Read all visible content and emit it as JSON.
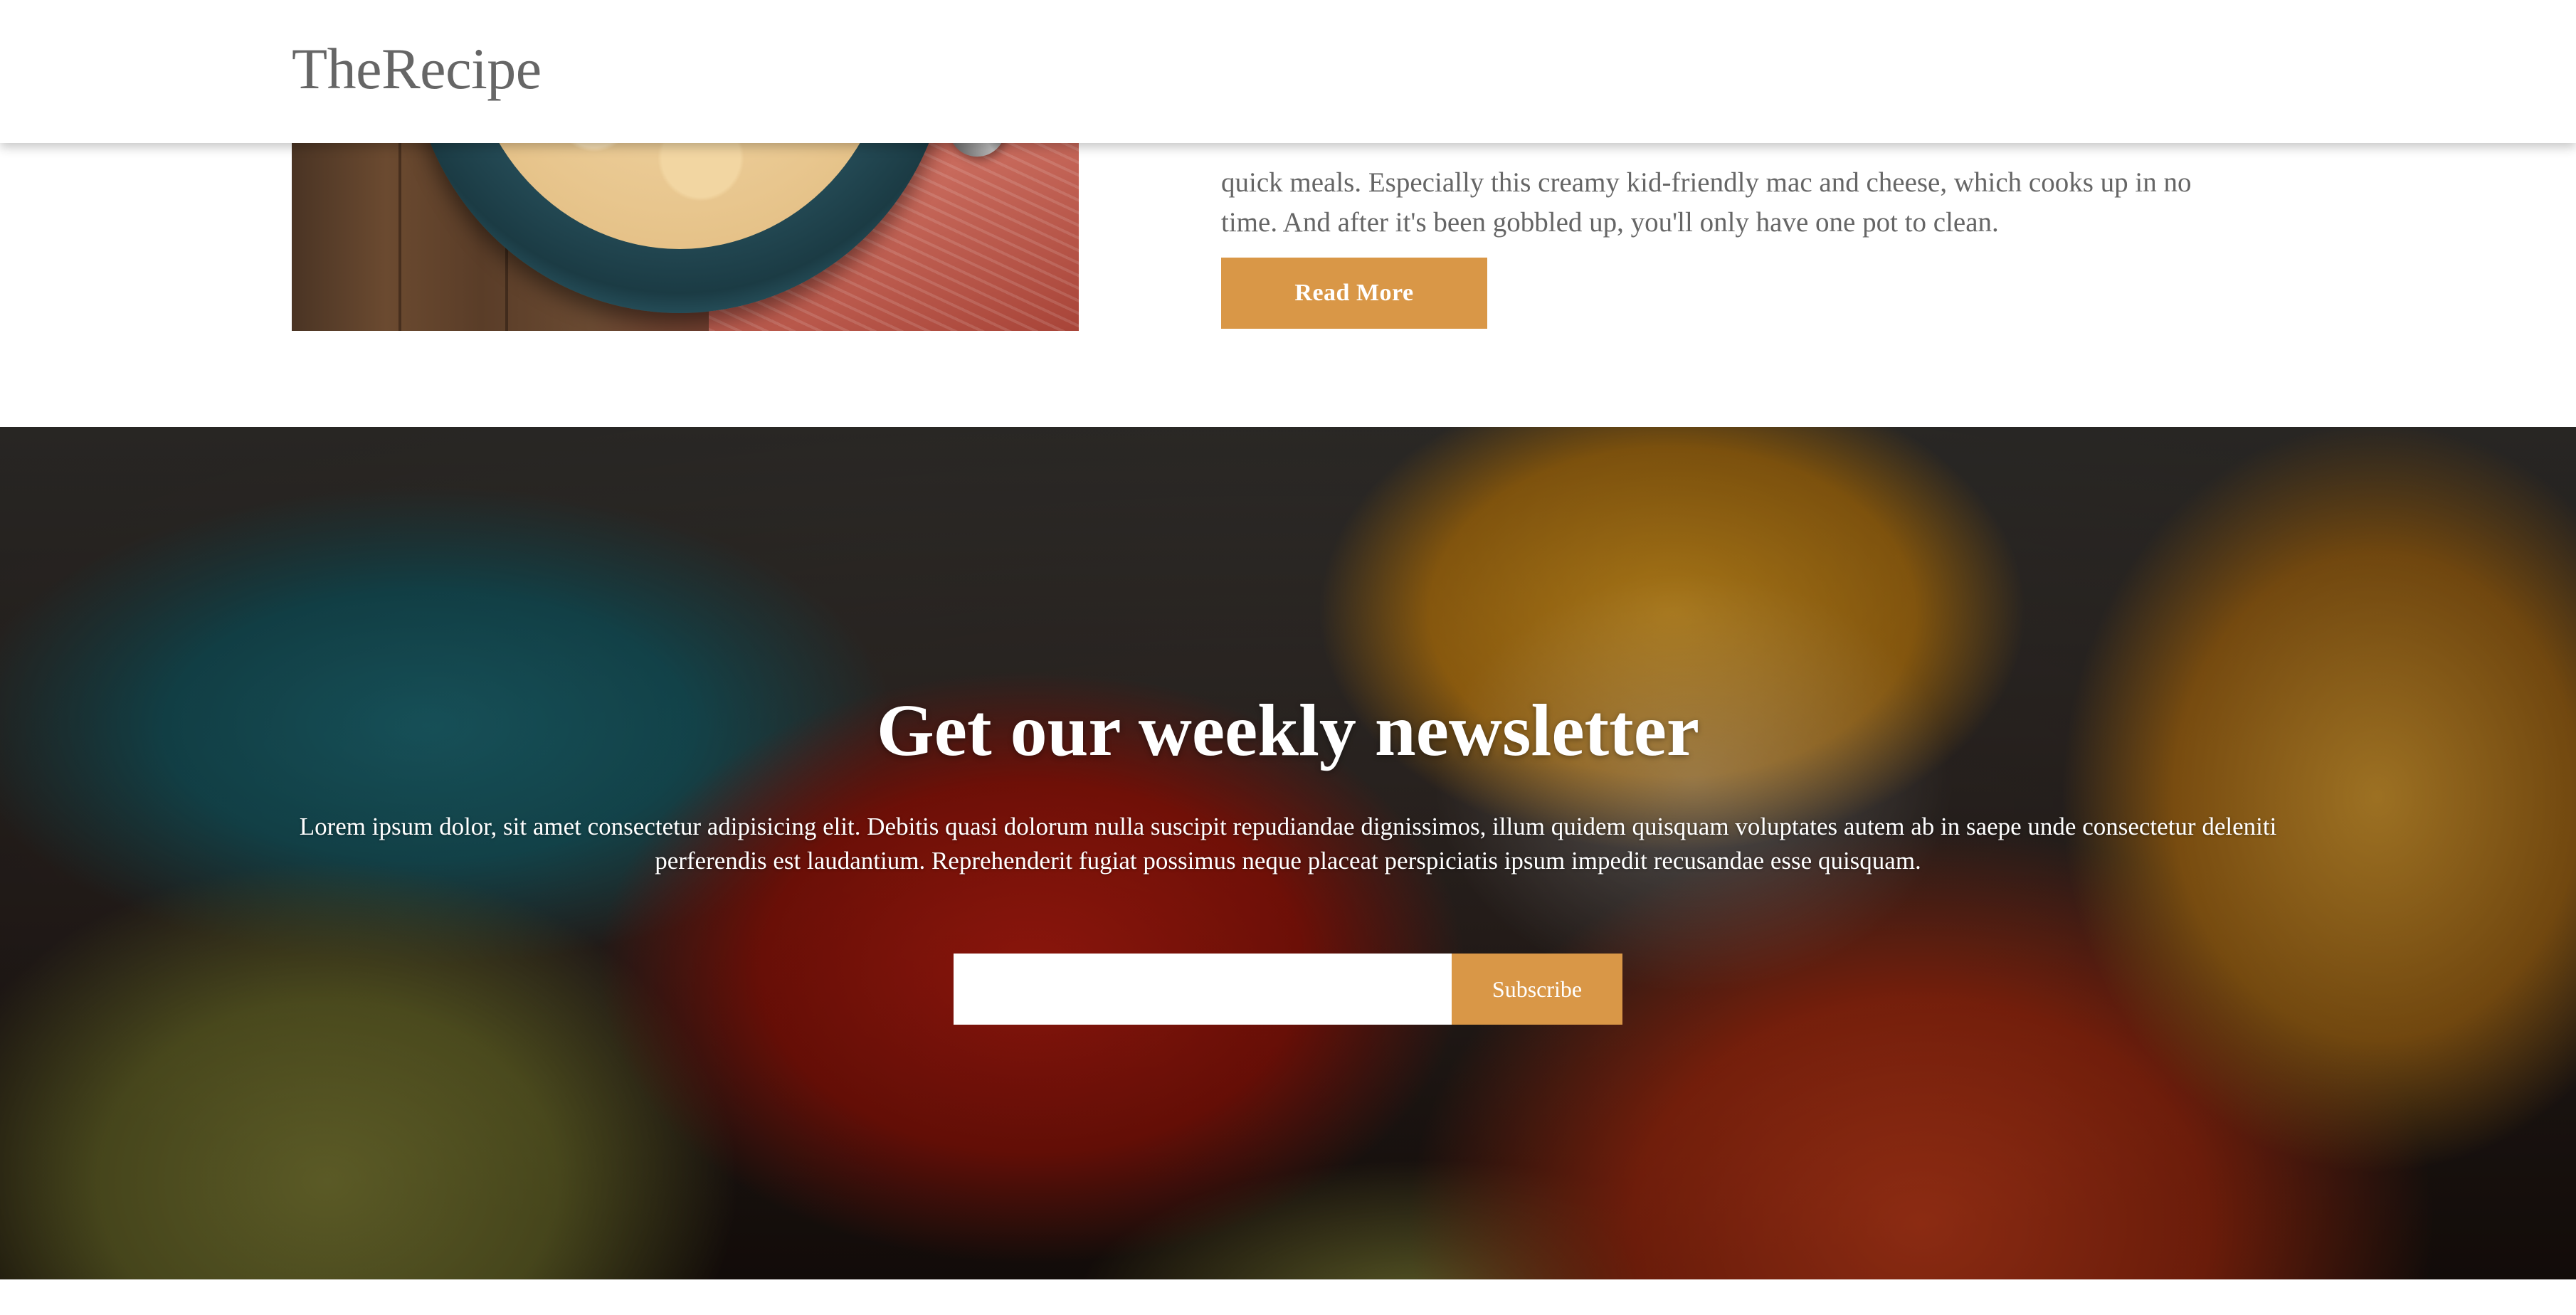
{
  "header": {
    "brand": "TheRecipe"
  },
  "featured_recipe": {
    "image_alt": "mac and cheese bowl",
    "excerpt": "quick meals. Especially this creamy kid-friendly mac and cheese, which cooks up in no time. And after it's been gobbled up, you'll only have one pot to clean.",
    "read_more_label": "Read More"
  },
  "newsletter": {
    "title": "Get our weekly newsletter",
    "description": "Lorem ipsum dolor, sit amet consectetur adipisicing elit. Debitis quasi dolorum nulla suscipit repudiandae dignissimos, illum quidem quisquam voluptates autem ab in saepe unde consectetur deleniti perferendis est laudantium. Reprehenderit fugiat possimus neque placeat perspiciatis ipsum impedit recusandae esse quisquam.",
    "email_value": "",
    "email_placeholder": "",
    "subscribe_label": "Subscribe"
  },
  "colors": {
    "accent": "#d99747",
    "text_muted": "#666666",
    "white": "#ffffff"
  }
}
